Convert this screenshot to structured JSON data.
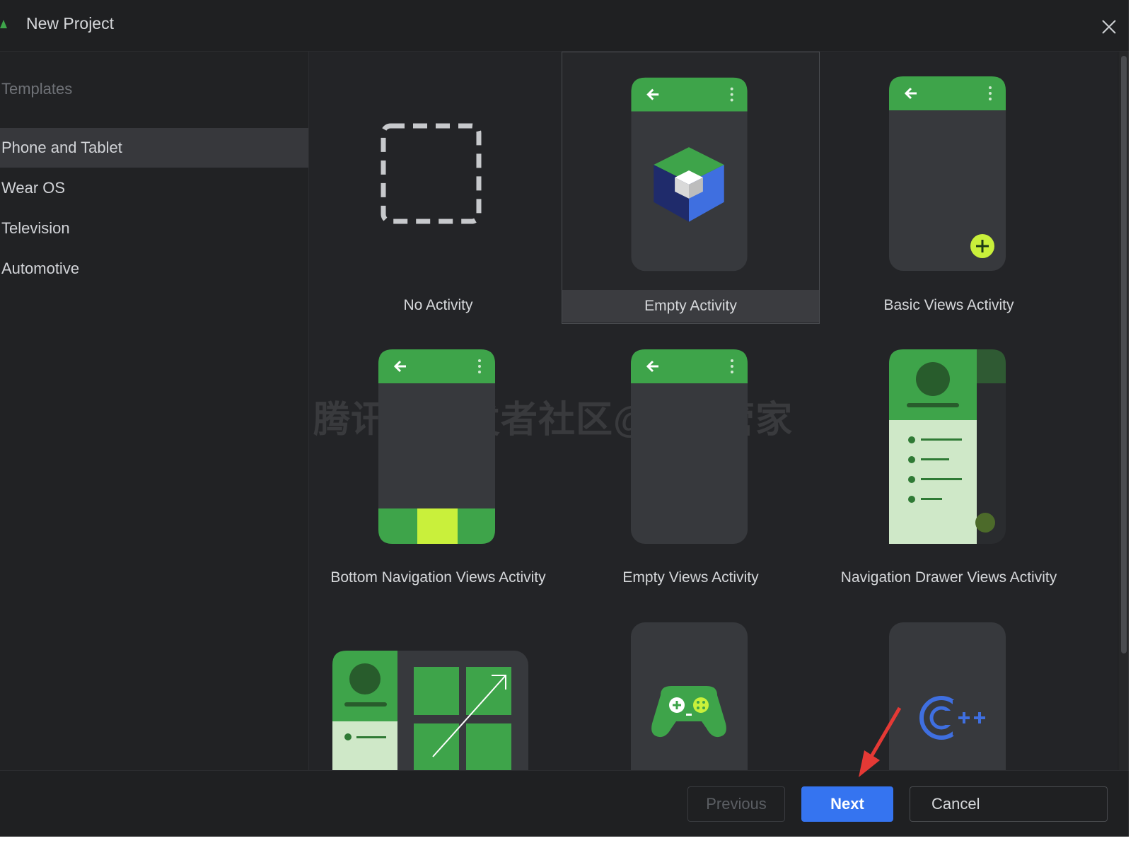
{
  "window": {
    "title": "New Project"
  },
  "sidebar": {
    "heading": "Templates",
    "items": [
      {
        "label": "Phone and Tablet",
        "selected": true
      },
      {
        "label": "Wear OS",
        "selected": false
      },
      {
        "label": "Television",
        "selected": false
      },
      {
        "label": "Automotive",
        "selected": false
      }
    ]
  },
  "templates": [
    {
      "label": "No Activity",
      "selected": false
    },
    {
      "label": "Empty Activity",
      "selected": true
    },
    {
      "label": "Basic Views Activity",
      "selected": false
    },
    {
      "label": "Bottom Navigation Views Activity",
      "selected": false
    },
    {
      "label": "Empty Views Activity",
      "selected": false
    },
    {
      "label": "Navigation Drawer Views Activity",
      "selected": false
    },
    {
      "label": "",
      "selected": false
    },
    {
      "label": "",
      "selected": false
    },
    {
      "label": "",
      "selected": false
    }
  ],
  "watermark": "腾讯云开发者社区@test管家",
  "footer": {
    "previous_label": "Previous",
    "next_label": "Next",
    "cancel_label": "Cancel"
  },
  "colors": {
    "accent_green": "#3ea44a",
    "light_green": "#c9f03b",
    "primary_button": "#3574f0",
    "background": "#222325",
    "annotation_arrow": "#e53935"
  },
  "icons": {
    "close": "close-icon",
    "back_arrow": "arrow-back-icon",
    "overflow_menu": "more-vert-icon",
    "fab": "plus-icon",
    "android_studio": "android-studio-cube-icon",
    "game": "gamepad-icon",
    "cpp": "cpp-icon"
  }
}
